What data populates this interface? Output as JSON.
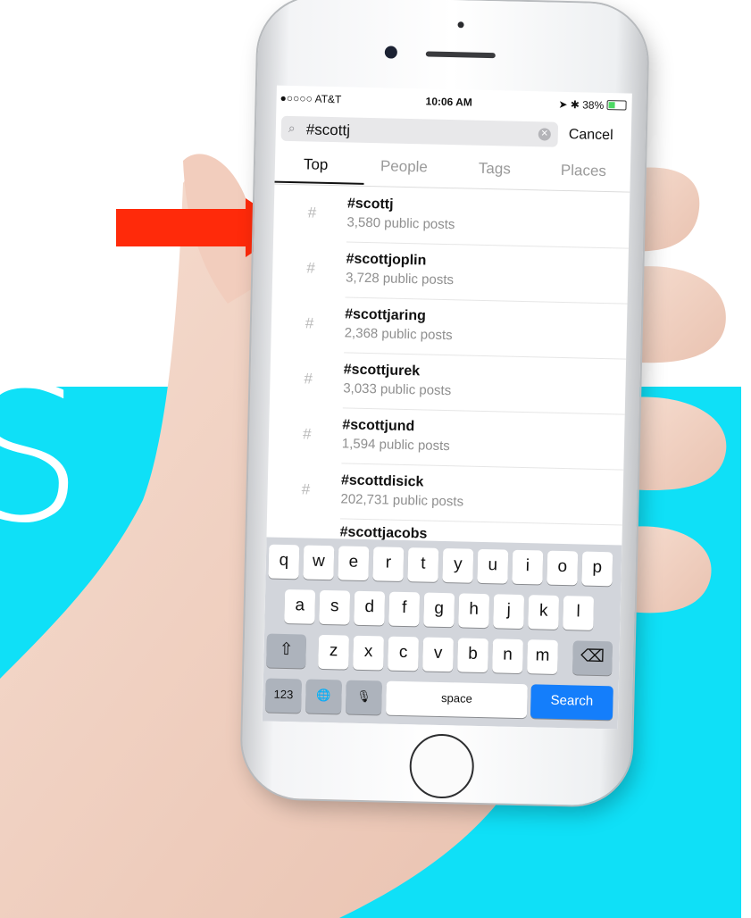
{
  "background": {
    "accent_color": "#0fe0f7",
    "big_letter": "S",
    "arrow_color": "#ff2a0a"
  },
  "status_bar": {
    "carrier": "●○○○○ AT&T",
    "time": "10:06 AM",
    "battery": "38%"
  },
  "search": {
    "query": "#scottj",
    "cancel_label": "Cancel"
  },
  "tabs": [
    {
      "label": "Top",
      "active": true
    },
    {
      "label": "People",
      "active": false
    },
    {
      "label": "Tags",
      "active": false
    },
    {
      "label": "Places",
      "active": false
    }
  ],
  "results": [
    {
      "icon": "#",
      "tag": "#scottj",
      "count": "3,580 public posts"
    },
    {
      "icon": "#",
      "tag": "#scottjoplin",
      "count": "3,728 public posts"
    },
    {
      "icon": "#",
      "tag": "#scottjaring",
      "count": "2,368 public posts"
    },
    {
      "icon": "#",
      "tag": "#scottjurek",
      "count": "3,033 public posts"
    },
    {
      "icon": "#",
      "tag": "#scottjund",
      "count": "1,594 public posts"
    },
    {
      "icon": "#",
      "tag": "#scottdisick",
      "count": "202,731 public posts"
    }
  ],
  "partial_result": "#scottjacobs",
  "keyboard": {
    "row1": [
      "q",
      "w",
      "e",
      "r",
      "t",
      "y",
      "u",
      "i",
      "o",
      "p"
    ],
    "row2": [
      "a",
      "s",
      "d",
      "f",
      "g",
      "h",
      "j",
      "k",
      "l"
    ],
    "row3": [
      "z",
      "x",
      "c",
      "v",
      "b",
      "n",
      "m"
    ],
    "shift": "⇧",
    "delete": "⌫",
    "numbers": "123",
    "globe": "🌐",
    "mic": "🎙",
    "space": "space",
    "search": "Search"
  }
}
